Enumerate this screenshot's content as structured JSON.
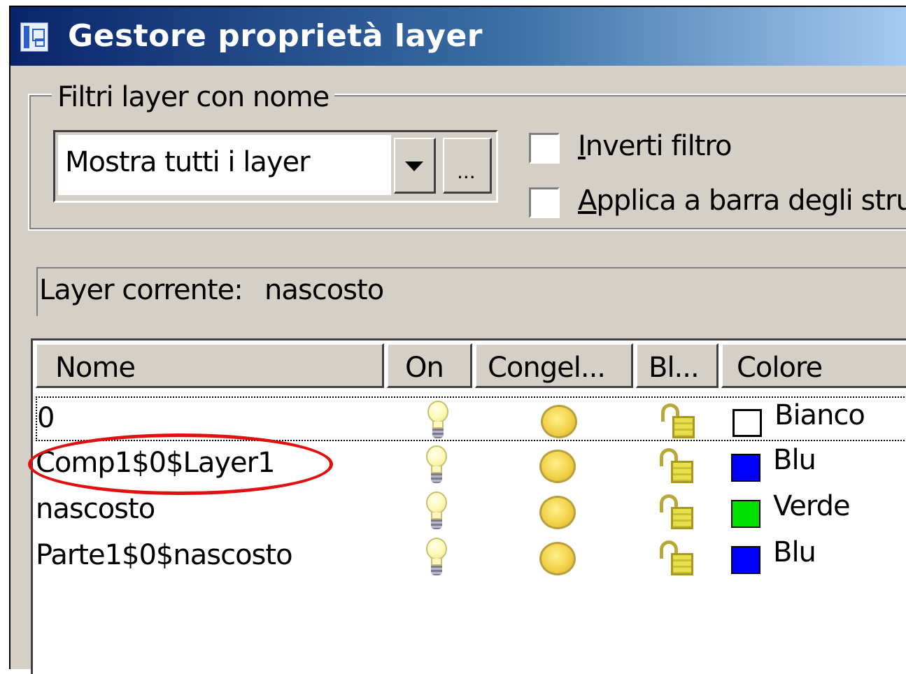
{
  "window": {
    "title": "Gestore proprietà layer",
    "title_icon": "layer-manager-icon"
  },
  "filter_group": {
    "label": "Filtri layer con nome",
    "combo_value": "Mostra tutti i layer",
    "dots_label": "...",
    "invert": {
      "mnemonic": "I",
      "rest": "nverti filtro",
      "checked": false
    },
    "apply": {
      "mnemonic": "A",
      "rest": "pplica a barra degli stru",
      "checked": false
    }
  },
  "current_layer": {
    "label": "Layer corrente:",
    "value": "nascosto"
  },
  "columns": [
    "Nome",
    "On",
    "Congel...",
    "Bl...",
    "Colore"
  ],
  "layers": [
    {
      "name": "0",
      "on": true,
      "frozen": false,
      "locked": false,
      "color_name": "Bianco",
      "color": "#ffffff"
    },
    {
      "name": "Comp1$0$Layer1",
      "on": true,
      "frozen": false,
      "locked": false,
      "color_name": "Blu",
      "color": "#0000ff"
    },
    {
      "name": "nascosto",
      "on": true,
      "frozen": false,
      "locked": false,
      "color_name": "Verde",
      "color": "#00e000"
    },
    {
      "name": "Parte1$0$nascosto",
      "on": true,
      "frozen": false,
      "locked": false,
      "color_name": "Blu",
      "color": "#0000ff"
    }
  ],
  "icons": {
    "on": "lightbulb-icon",
    "freeze": "sun-icon",
    "lock": "padlock-icon"
  },
  "annotation": {
    "highlight_color": "#e01010"
  }
}
